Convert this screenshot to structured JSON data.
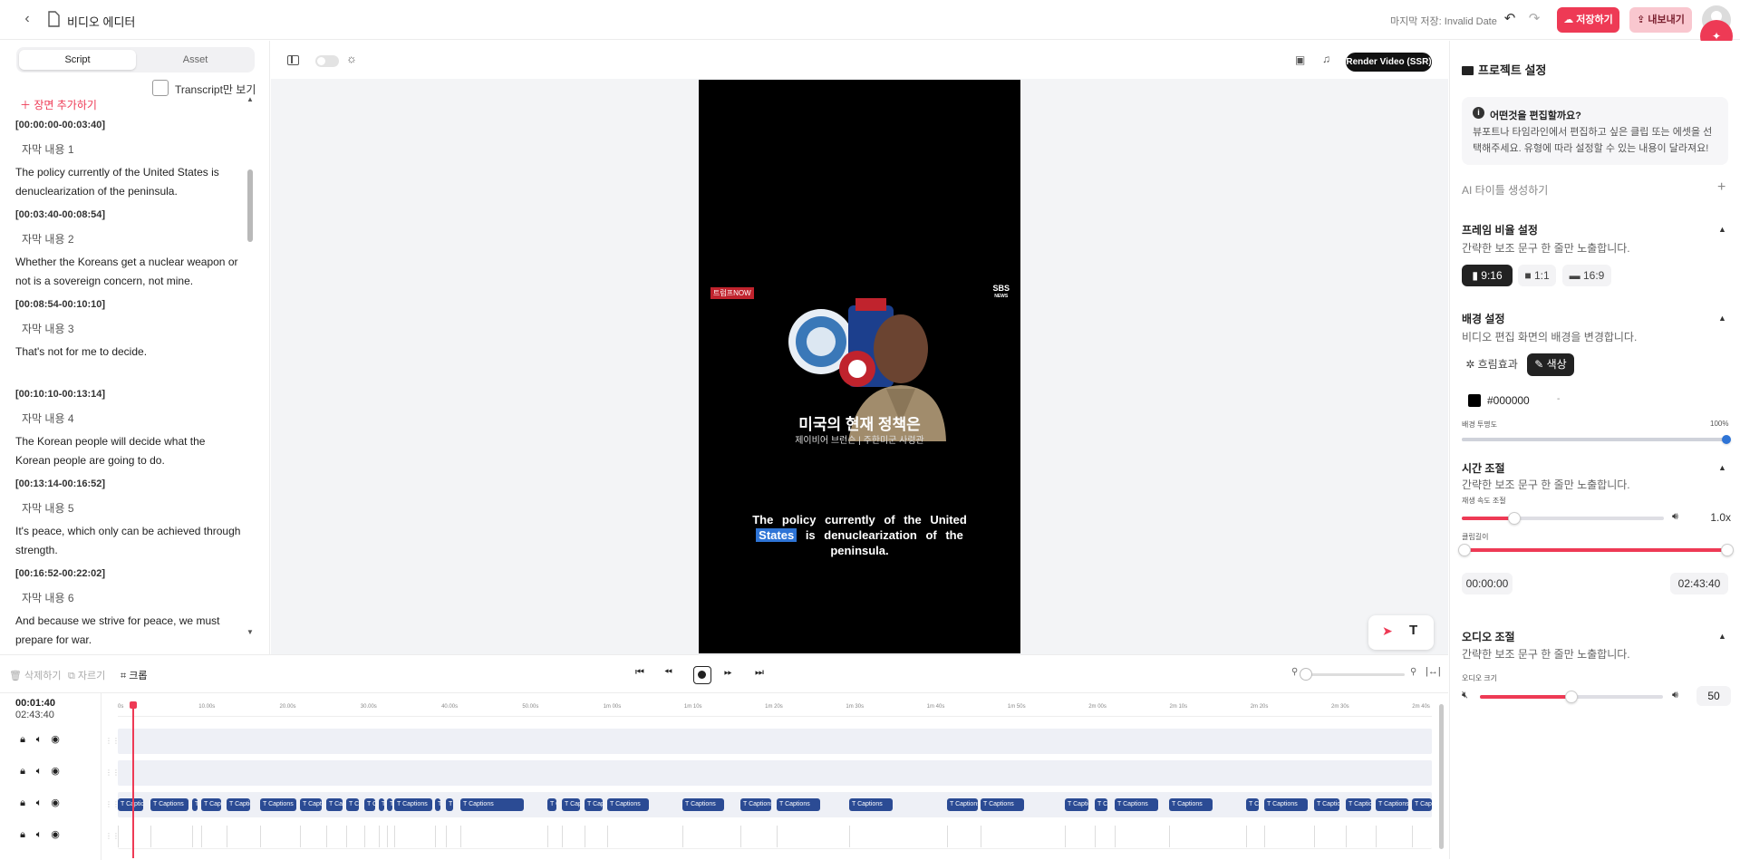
{
  "topbar": {
    "title": "비디오 에디터",
    "saved_status": "마지막 저장: Invalid Date",
    "save_label": "저장하기",
    "export_label": "내보내기"
  },
  "left": {
    "tabs": [
      "Script",
      "Asset"
    ],
    "transcript_only": "Transcript만 보기",
    "add_scene": "장면 추가하기",
    "scenes": [
      {
        "time": "[00:00:00-00:03:40]",
        "sub": "자막 내용 1",
        "text": "The policy currently of the United States is denuclearization of the peninsula."
      },
      {
        "time": "[00:03:40-00:08:54]",
        "sub": "자막 내용 2",
        "text": "Whether the Koreans get a nuclear weapon or not is a sovereign concern, not mine."
      },
      {
        "time": "[00:08:54-00:10:10]",
        "sub": "자막 내용 3",
        "text": "That's not for me to decide."
      },
      {
        "time": "[00:10:10-00:13:14]",
        "sub": "자막 내용 4",
        "text": "The Korean people will decide what the Korean people are going to do."
      },
      {
        "time": "[00:13:14-00:16:52]",
        "sub": "자막 내용 5",
        "text": "It's peace, which only can be achieved through strength."
      },
      {
        "time": "[00:16:52-00:22:02]",
        "sub": "자막 내용 6",
        "text": "And because we strive for peace, we must prepare for war."
      }
    ]
  },
  "center": {
    "render_label": "Render Video (SSR)",
    "video": {
      "badge": "트럼프NOW",
      "logo_top": "SBS",
      "logo_bottom": "NEWS",
      "title": "미국의 현재 정책은",
      "subtitle": "제이비어 브런슨 | 주한미군 사령관",
      "caption_before": "The policy currently of the United",
      "caption_highlight": "States",
      "caption_after": "is denuclearization of the peninsula."
    }
  },
  "right": {
    "header": "프로젝트 설정",
    "info_title": "어떤것을 편집할까요?",
    "info_text": "뷰포트나 타임라인에서 편집하고 싶은 클립 또는 에셋을 선택해주세요. 유형에 따라 설정할 수 있는 내용이 달라져요!",
    "ai_title": "AI 타이틀 생성하기",
    "frame_title": "프레임 비율 설정",
    "frame_desc": "간략한 보조 문구 한 줄만 노출합니다.",
    "ratios": [
      "9:16",
      "1:1",
      "16:9"
    ],
    "bg_title": "배경 설정",
    "bg_desc": "비디오 편집 화면의 배경을 변경합니다.",
    "bg_blur": "흐림효과",
    "bg_color": "색상",
    "bg_hex": "#000000",
    "bg_opacity_label": "배경 투명도",
    "bg_opacity_value": "100%",
    "bg_opacity": 1.0,
    "time_title": "시간 조절",
    "time_desc": "간략한 보조 문구 한 줄만 노출합니다.",
    "speed_label": "재생 속도 조절",
    "speed_value": "1.0x",
    "speed_fraction": 0.26,
    "clip_length_label": "클립길이",
    "clip_start": "00:00:00",
    "clip_end": "02:43:40",
    "audio_title": "오디오 조절",
    "audio_desc": "간략한 보조 문구 한 줄만 노출합니다.",
    "volume_label": "오디오 크기",
    "volume_value": "50",
    "volume_fraction": 0.5,
    "accent": "#ee3a55"
  },
  "timeline_controls": {
    "delete": "삭제하기",
    "cut": "자르기",
    "crop": "크롭"
  },
  "timeline": {
    "current": "00:01:40",
    "total": "02:43:40",
    "ticks": [
      "0s",
      "10.00s",
      "20.00s",
      "30.00s",
      "40.00s",
      "50.00s",
      "1m 00s",
      "1m 10s",
      "1m 20s",
      "1m 30s",
      "1m 40s",
      "1m 50s",
      "2m 00s",
      "2m 10s",
      "2m 20s",
      "2m 30s",
      "2m 40s"
    ],
    "clip_label": "Captions",
    "clip_color": "#2b4b94"
  }
}
